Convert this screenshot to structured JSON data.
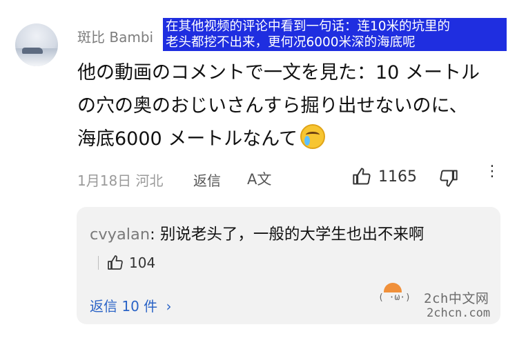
{
  "comment": {
    "username": "斑比 Bambi",
    "overlay_lines": [
      "在其他视频的评论中看到一句话：连10米的坑里的",
      "老头都挖不出来，更何况6000米深的海底呢"
    ],
    "text_line1": "他の動画のコメントで一文を見た：10 メートル",
    "text_line2": "の穴の奥のおじいさんすら掘り出せないのに、",
    "text_line3": "海底6000 メートルなんて",
    "emoji_icon": "crying-laughing-emoji",
    "date_location": "1月18日 河北",
    "reply_label": "返信",
    "translate_icon": "A文",
    "like_count": "1165",
    "more_icon": "⋮"
  },
  "reply": {
    "user": "cvyalan",
    "text": ": 别说老头了，一般的大学生也出不来啊",
    "like_count": "104",
    "view_replies": "返信 10 件"
  },
  "watermark": {
    "line1": "2ch中文网",
    "line2": "2chcn.com",
    "face_text": "(  ·ω·)"
  },
  "colors": {
    "overlay_bg": "#1f2ee0",
    "link_blue": "#2a63c6",
    "card_bg": "#f2f2f2"
  }
}
